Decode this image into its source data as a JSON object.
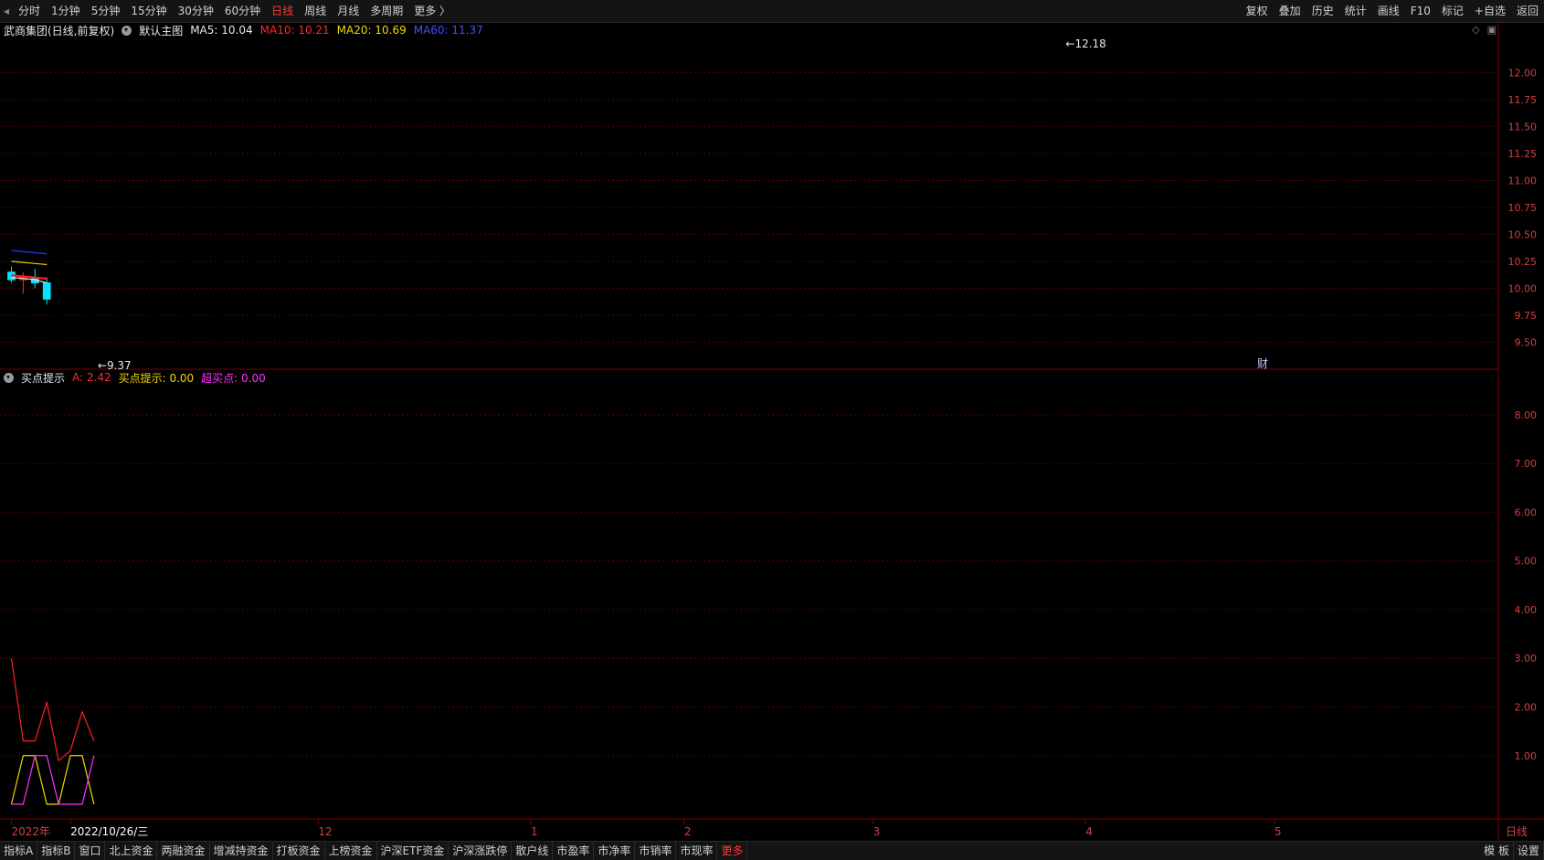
{
  "toolbar": {
    "periods": [
      "分时",
      "1分钟",
      "5分钟",
      "15分钟",
      "30分钟",
      "60分钟",
      "日线",
      "周线",
      "月线",
      "多周期",
      "更多 〉"
    ],
    "active_period": "日线",
    "right_buttons": [
      "复权",
      "叠加",
      "历史",
      "统计",
      "画线",
      "F10",
      "标记",
      "+自选",
      "返回"
    ]
  },
  "main_header": {
    "title": "武商集团(日线,前复权)",
    "overlay": "默认主图",
    "ma5": "MA5: 10.04",
    "ma10": "MA10: 10.21",
    "ma20": "MA20: 10.69",
    "ma60": "MA60: 11.37"
  },
  "sub_header": {
    "title": "买点提示",
    "a": "A: 2.42",
    "buy": "买点提示: 0.00",
    "super": "超买点: 0.00"
  },
  "colors": {
    "up": "#ff2a2a",
    "down": "#00e5ff",
    "ma5": "#e8e8e8",
    "ma10": "#ff1a1a",
    "ma20": "#e6c800",
    "ma60": "#2030d0",
    "grid": "#5a0000"
  },
  "chart_data": [
    {
      "type": "candlestick",
      "title": "武商集团(日线,前复权)",
      "ylim": [
        9.25,
        12.3
      ],
      "y_ticks": [
        9.5,
        9.75,
        10.0,
        10.25,
        10.5,
        10.75,
        11.0,
        11.25,
        11.5,
        11.75,
        12.0
      ],
      "y_tick_labels": [
        "9.50",
        "9.75",
        "10.00",
        "10.25",
        "10.50",
        "10.75",
        "11.00",
        "11.25",
        "11.50",
        "11.75",
        "12.00"
      ],
      "annotations": [
        {
          "text": "12.18",
          "index": 89,
          "value": 12.18,
          "pos": "high"
        },
        {
          "text": "9.37",
          "index": 7,
          "value": 9.37,
          "pos": "low"
        }
      ],
      "marker_text": "财",
      "marker_index": 106,
      "x_labels": [
        {
          "text": "2022年",
          "index": 0
        },
        {
          "text": "2022/10/26/三",
          "index": 5
        },
        {
          "text": "12",
          "index": 26
        },
        {
          "text": "1",
          "index": 44
        },
        {
          "text": "2",
          "index": 57
        },
        {
          "text": "3",
          "index": 73
        },
        {
          "text": "4",
          "index": 91
        },
        {
          "text": "5",
          "index": 107
        },
        {
          "text": "日线",
          "index": 122
        }
      ],
      "candles": [
        {
          "open": 10.15,
          "high": 10.2,
          "low": 10.05,
          "close": 10.08
        },
        {
          "open": 10.08,
          "high": 10.15,
          "low": 9.95,
          "close": 10.1
        },
        {
          "open": 10.1,
          "high": 10.18,
          "low": 10.0,
          "close": 10.05
        },
        {
          "open": 10.05,
          "high": 10.1,
          "low": 9.85,
          "close": 9.9
        }
      ],
      "ma5": [
        10.1,
        10.09,
        10.08,
        10.05
      ],
      "ma10": [
        10.12,
        10.11,
        10.1,
        10.09
      ],
      "ma20": [
        10.25,
        10.24,
        10.23,
        10.22
      ],
      "ma60": [
        10.35,
        10.34,
        10.33,
        10.32
      ]
    },
    {
      "type": "line",
      "title": "买点提示",
      "ylim": [
        -0.3,
        8.6
      ],
      "y_ticks": [
        1,
        2,
        3,
        4,
        5,
        6,
        7,
        8
      ],
      "y_tick_labels": [
        "1.00",
        "2.00",
        "3.00",
        "4.00",
        "5.00",
        "6.00",
        "7.00",
        "8.00"
      ],
      "series": [
        {
          "name": "A",
          "values": [
            3.0,
            1.3,
            1.3,
            2.1,
            0.9,
            1.1,
            1.9,
            1.3
          ]
        },
        {
          "name": "买点提示",
          "values": [
            0,
            1,
            1,
            0,
            0,
            1,
            1,
            0
          ]
        },
        {
          "name": "超买点",
          "values": [
            0,
            0,
            1,
            1,
            0,
            0,
            0,
            1
          ]
        }
      ]
    }
  ],
  "bottom_tabs": [
    "指标A",
    "指标B",
    "窗口",
    "北上资金",
    "两融资金",
    "增减持资金",
    "打板资金",
    "上榜资金",
    "沪深ETF资金",
    "沪深涨跌停",
    "散户线",
    "市盈率",
    "市净率",
    "市销率",
    "市现率",
    "更多"
  ],
  "bottom_right": [
    "模 板",
    "设置"
  ]
}
